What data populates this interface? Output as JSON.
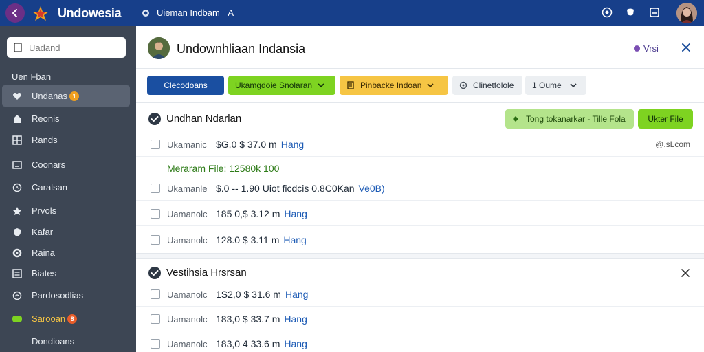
{
  "app": {
    "brand": "Undowesia",
    "breadcrumb": "Uieman Indbam",
    "breadcrumb_suffix": "A"
  },
  "sidebar": {
    "search_placeholder": "Uadand",
    "heading": "Uen Fban",
    "items": [
      {
        "label": "Undanas",
        "icon": "heart-icon",
        "badge": "1",
        "active": true
      },
      {
        "label": "Reonis",
        "icon": "pin-icon"
      },
      {
        "label": "Rands",
        "icon": "grid-icon"
      },
      {
        "label": "Coonars",
        "icon": "window-icon"
      },
      {
        "label": "Caralsan",
        "icon": "clock-icon"
      },
      {
        "label": "Prvols",
        "icon": "pin-icon"
      },
      {
        "label": "Kafar",
        "icon": "shield-icon"
      },
      {
        "label": "Raina",
        "icon": "gear-icon"
      },
      {
        "label": "Biates",
        "icon": "list-icon"
      },
      {
        "label": "Pardosodlias",
        "icon": "globe-icon"
      },
      {
        "label": "Sarooan",
        "icon": "leaf-icon",
        "badge": "8",
        "highlight": true
      },
      {
        "label": "Dondioans",
        "icon": ""
      }
    ]
  },
  "header": {
    "title": "Undownhliaan Indansia",
    "version": "Vrsi"
  },
  "toolbar": {
    "primary": "Clecodoans",
    "green_dropdown": "Ukamgdoie Snolaran",
    "yellow_dropdown": "Pinbacke Indoan",
    "icon_button": "Clinetfolole",
    "count_select": "1 Oume"
  },
  "section1": {
    "title": "Undhan Ndarlan",
    "tag": "Tong tokanarkar - Tille Fola",
    "action": "Ukter File",
    "note": "Meraram File: 12580k 100",
    "rows": [
      {
        "label": "Ukamanic",
        "value": "$G,0 $ 37.0 m",
        "link": "Hang",
        "right": "@.sLcom"
      },
      {
        "label": "Ukamanle",
        "value": "$.0 -- 1.90 Uiot ficdcis 0.8C0Kan",
        "link": "Ve0B)",
        "right": ""
      },
      {
        "label": "Uamanolc",
        "value": "185 0,$ 3.12 m",
        "link": "Hang",
        "right": ""
      },
      {
        "label": "Uamanolc",
        "value": "128.0 $ 3.11 m",
        "link": "Hang",
        "right": ""
      }
    ]
  },
  "section2": {
    "title": "Vestihsia Hrsrsan",
    "rows": [
      {
        "label": "Uamanolc",
        "value": "1S2,0 $ 31.6 m",
        "link": "Hang"
      },
      {
        "label": "Uamanolc",
        "value": "183,0 $ 33.7 m",
        "link": "Hang"
      },
      {
        "label": "Uamanolc",
        "value": "183,0 4 33.6 m",
        "link": "Hang"
      }
    ]
  },
  "colors": {
    "topbar": "#173f8a",
    "sidebar": "#3d4654",
    "primary_btn": "#1a4fa1",
    "green": "#7ed321",
    "yellow": "#f6c544",
    "link": "#1d5bb5"
  }
}
